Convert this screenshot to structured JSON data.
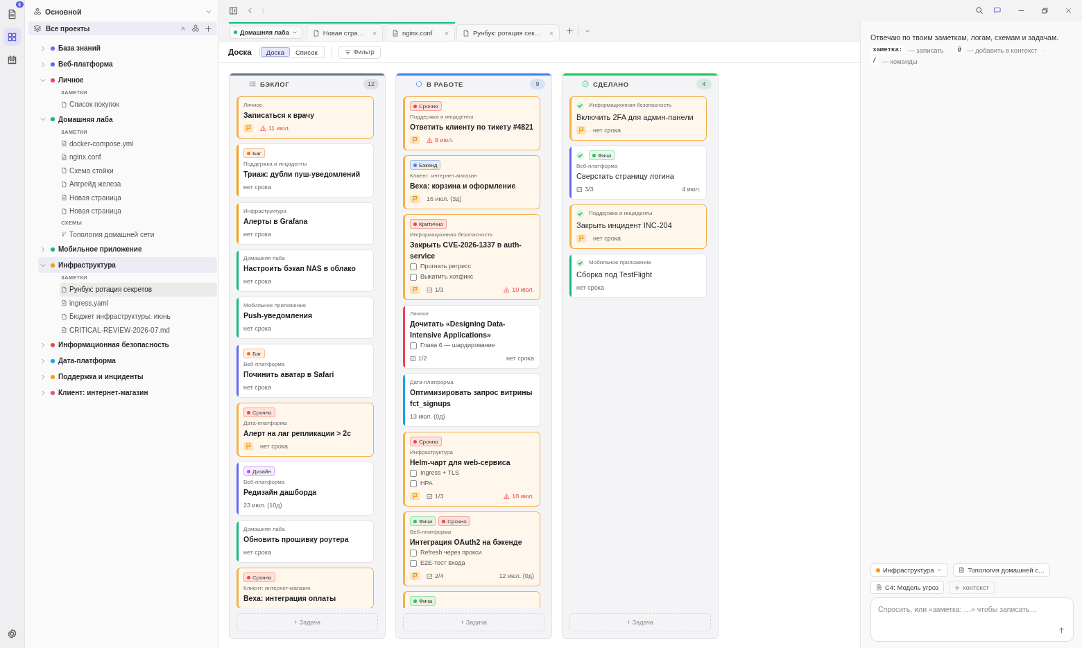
{
  "activity_bar": {
    "items": [
      {
        "kind": "notes",
        "selected": false,
        "badge": "3"
      },
      {
        "kind": "board",
        "selected": true
      },
      {
        "kind": "calendar",
        "selected": false
      }
    ]
  },
  "sidebar": {
    "workspace": "Основной",
    "all_projects": {
      "label": "Все проекты",
      "selected": true
    },
    "projects": [
      {
        "name": "База знаний",
        "color": "#8b5cf6",
        "expanded": false,
        "selected": false
      },
      {
        "name": "Веб-платформа",
        "color": "#6366f1",
        "expanded": false,
        "selected": false
      },
      {
        "name": "Личное",
        "color": "#f43f5e",
        "expanded": true,
        "selected": false,
        "sections": [
          {
            "heading": "ЗАМЕТКИ",
            "notes": [
              {
                "label": "Список покупок",
                "kind": "page",
                "selected": false
              }
            ]
          }
        ]
      },
      {
        "name": "Домашняя лаба",
        "color": "#10b981",
        "expanded": true,
        "selected": false,
        "sections": [
          {
            "heading": "ЗАМЕТКИ",
            "notes": [
              {
                "label": "docker-compose.yml",
                "kind": "code",
                "selected": false
              },
              {
                "label": "nginx.conf",
                "kind": "code",
                "selected": false
              },
              {
                "label": "Схема стойки",
                "kind": "page",
                "selected": false
              },
              {
                "label": "Апгрейд железа",
                "kind": "page",
                "selected": false
              },
              {
                "label": "Новая страница",
                "kind": "code",
                "selected": false
              },
              {
                "label": "Новая страница",
                "kind": "page",
                "selected": false
              }
            ]
          },
          {
            "heading": "СХЕМЫ",
            "notes": [
              {
                "label": "Топология домашней сети",
                "kind": "diagram",
                "selected": false
              }
            ]
          }
        ]
      },
      {
        "name": "Мобильное приложение",
        "color": "#10b981",
        "expanded": false,
        "selected": false
      },
      {
        "name": "Инфраструктура",
        "color": "#f59e0b",
        "expanded": true,
        "selected": true,
        "sections": [
          {
            "heading": "ЗАМЕТКИ",
            "notes": [
              {
                "label": "Рунбук: ротация секретов",
                "kind": "page",
                "selected": true
              },
              {
                "label": "ingress.yaml",
                "kind": "code",
                "selected": false
              },
              {
                "label": "Бюджет инфраструктуры: июнь",
                "kind": "page",
                "selected": false
              },
              {
                "label": "CRITICAL-REVIEW-2026-07.md",
                "kind": "code",
                "selected": false
              }
            ]
          }
        ]
      },
      {
        "name": "Информационная безопасность",
        "color": "#ef4444",
        "expanded": false,
        "selected": false
      },
      {
        "name": "Дата-платформа",
        "color": "#0ea5e9",
        "expanded": false,
        "selected": false
      },
      {
        "name": "Поддержка и инциденты",
        "color": "#f59e0b",
        "expanded": false,
        "selected": false
      },
      {
        "name": "Клиент: интернет-магазин",
        "color": "#ec4899",
        "expanded": false,
        "selected": false
      }
    ]
  },
  "navigation": {
    "forward_enabled": false
  },
  "tab_bar": {
    "group": {
      "label": "Домашняя лаба",
      "tabs": [
        {
          "label": "Новая стра…",
          "kind": "page"
        },
        {
          "label": "nginx.conf",
          "kind": "code"
        }
      ]
    },
    "tabs": [
      {
        "label": "Рунбук: ротация сек…",
        "kind": "page"
      }
    ]
  },
  "toolbar": {
    "title": "Доска",
    "views": [
      {
        "label": "Доска",
        "selected": true
      },
      {
        "label": "Список",
        "selected": false
      }
    ],
    "filter": "Фильтр"
  },
  "board": {
    "columns": [
      {
        "title": "БЭКЛОГ",
        "kind": "backlog",
        "color": "#64748b",
        "count": "12",
        "add_label": "+ Задача",
        "cards": [
          {
            "project": "Личное",
            "title": "Записаться к врачу",
            "flagged": true,
            "due": {
              "text": "11 июл.",
              "overdue": true
            }
          },
          {
            "tags": [
              {
                "label": "Баг",
                "color": "#f97316"
              }
            ],
            "project": "Поддержка и инциденты",
            "title": "Триаж: дубли пуш-уведомлений",
            "flagged": false,
            "color": "#f59e0b",
            "due": {
              "text": "нет срока",
              "overdue": false
            }
          },
          {
            "project": "Инфраструктура",
            "title": "Алерты в Grafana",
            "flagged": false,
            "color": "#f59e0b",
            "due": {
              "text": "нет срока",
              "overdue": false
            }
          },
          {
            "project": "Домашняя лаба",
            "title": "Настроить бэкап NAS в облако",
            "flagged": false,
            "color": "#10b981",
            "due": {
              "text": "нет срока",
              "overdue": false
            }
          },
          {
            "project": "Мобильное приложение",
            "title": "Push-уведомления",
            "flagged": false,
            "color": "#10b981",
            "due": {
              "text": "нет срока",
              "overdue": false
            }
          },
          {
            "tags": [
              {
                "label": "Баг",
                "color": "#f97316"
              }
            ],
            "project": "Веб-платформа",
            "title": "Починить аватар в Safari",
            "flagged": false,
            "color": "#6366f1",
            "due": {
              "text": "нет срока",
              "overdue": false
            }
          },
          {
            "tags": [
              {
                "label": "Срочно",
                "color": "#ef4444"
              }
            ],
            "project": "Дата-платформа",
            "title": "Алерт на лаг репликации > 2с",
            "flagged": true,
            "due": {
              "text": "нет срока",
              "overdue": false
            }
          },
          {
            "tags": [
              {
                "label": "Дизайн",
                "color": "#a855f7"
              }
            ],
            "project": "Веб-платформа",
            "title": "Редизайн дашборда",
            "flagged": false,
            "color": "#6366f1",
            "due": {
              "text": "23 июл. (10д)",
              "overdue": false
            }
          },
          {
            "project": "Домашняя лаба",
            "title": "Обновить прошивку роутера",
            "flagged": false,
            "color": "#10b981",
            "due": {
              "text": "нет срока",
              "overdue": false
            }
          },
          {
            "tags": [
              {
                "label": "Срочно",
                "color": "#ef4444"
              }
            ],
            "project": "Клиент: интернет-магазин",
            "title": "Веха: интеграция оплаты",
            "flagged": true
          }
        ]
      },
      {
        "title": "В РАБОТЕ",
        "kind": "in_progress",
        "color": "#3b82f6",
        "count": "9",
        "add_label": "+ Задача",
        "cards": [
          {
            "tags": [
              {
                "label": "Срочно",
                "color": "#ef4444"
              }
            ],
            "project": "Поддержка и инциденты",
            "title": "Ответить клиенту по тикету #4821",
            "flagged": true,
            "due": {
              "text": "9 июл.",
              "overdue": true
            }
          },
          {
            "tags": [
              {
                "label": "Бэкенд",
                "color": "#3b82f6"
              }
            ],
            "project": "Клиент: интернет-магазин",
            "title": "Веха: корзина и оформление",
            "flagged": true,
            "due": {
              "text": "16 июл. (3д)",
              "overdue": false
            }
          },
          {
            "tags": [
              {
                "label": "Критично",
                "color": "#ef4444"
              }
            ],
            "project": "Информационная безопасность",
            "title": "Закрыть CVE-2026-1337 в auth-service",
            "flagged": true,
            "checklist": [
              {
                "label": "Прогнать регресс",
                "checked": false
              },
              {
                "label": "Выкатить хотфикс",
                "checked": false
              }
            ],
            "progress": "1/3",
            "due": {
              "text": "10 июл.",
              "overdue": true
            }
          },
          {
            "project": "Личное",
            "title": "Дочитать «Designing Data-Intensive Applications»",
            "flagged": false,
            "color": "#f43f5e",
            "checklist": [
              {
                "label": "Глава 6 — шардирование",
                "checked": false
              }
            ],
            "progress": "1/2",
            "due": {
              "text": "нет срока",
              "overdue": false
            }
          },
          {
            "project": "Дата-платформа",
            "title": "Оптимизировать запрос витрины fct_signups",
            "flagged": false,
            "color": "#0ea5e9",
            "due": {
              "text": "13 июл. (0д)",
              "overdue": false
            }
          },
          {
            "tags": [
              {
                "label": "Срочно",
                "color": "#ef4444"
              }
            ],
            "project": "Инфраструктура",
            "title": "Helm-чарт для web-сервиса",
            "flagged": true,
            "checklist": [
              {
                "label": "Ingress + TLS",
                "checked": false
              },
              {
                "label": "HPA",
                "checked": false
              }
            ],
            "progress": "1/3",
            "due": {
              "text": "10 июл.",
              "overdue": true
            }
          },
          {
            "tags": [
              {
                "label": "Фича",
                "color": "#22c55e"
              },
              {
                "label": "Срочно",
                "color": "#ef4444"
              }
            ],
            "project": "Веб-платформа",
            "title": "Интеграция OAuth2 на бэкенде",
            "flagged": true,
            "checklist": [
              {
                "label": "Refresh через прокси",
                "checked": false
              },
              {
                "label": "E2E-тест входа",
                "checked": false
              }
            ],
            "progress": "2/4",
            "due": {
              "text": "12 июл. (0д)",
              "overdue": false
            }
          },
          {
            "tags": [
              {
                "label": "Фича",
                "color": "#22c55e"
              }
            ],
            "flagged": true
          }
        ]
      },
      {
        "title": "СДЕЛАНО",
        "kind": "done",
        "color": "#22c55e",
        "count": "4",
        "add_label": "+ Задача",
        "cards": [
          {
            "project": "Информационная безопасность",
            "title": "Включить 2FA для админ-панели",
            "flagged": true,
            "due": {
              "text": "нет срока",
              "overdue": false
            }
          },
          {
            "tags": [
              {
                "label": "Фича",
                "color": "#22c55e"
              }
            ],
            "project": "Веб-платформа",
            "title": "Сверстать страницу логина",
            "flagged": false,
            "color": "#6366f1",
            "progress": "3/3",
            "due": {
              "text": "4 июл.",
              "overdue": false
            }
          },
          {
            "project": "Поддержка и инциденты",
            "title": "Закрыть инцидент INC-204",
            "flagged": true,
            "due": {
              "text": "нет срока",
              "overdue": false
            }
          },
          {
            "project": "Мобильное приложение",
            "title": "Сборка под TestFlight",
            "flagged": false,
            "color": "#10b981",
            "due": {
              "text": "нет срока",
              "overdue": false
            }
          }
        ]
      }
    ]
  },
  "assistant": {
    "intro": "Отвечаю по твоим заметкам, логам, схемам и задачам.",
    "hints": [
      {
        "key": "заметка:",
        "text": "— записать",
        "separator": "·"
      },
      {
        "key": "@",
        "text": "— добавить в контекст",
        "separator": "·"
      },
      {
        "key": "/",
        "text": "— команды"
      }
    ],
    "context": [
      {
        "kind": "project",
        "label": "Инфраструктура",
        "color": "#f59e0b"
      },
      {
        "kind": "note",
        "label": "Топология домашней с…"
      },
      {
        "kind": "note",
        "label": "C4: Модель угроз"
      },
      {
        "kind": "add",
        "label": "контекст"
      }
    ],
    "input": {
      "placeholder": "Спросить, или «заметка: …» чтобы записать…"
    }
  }
}
